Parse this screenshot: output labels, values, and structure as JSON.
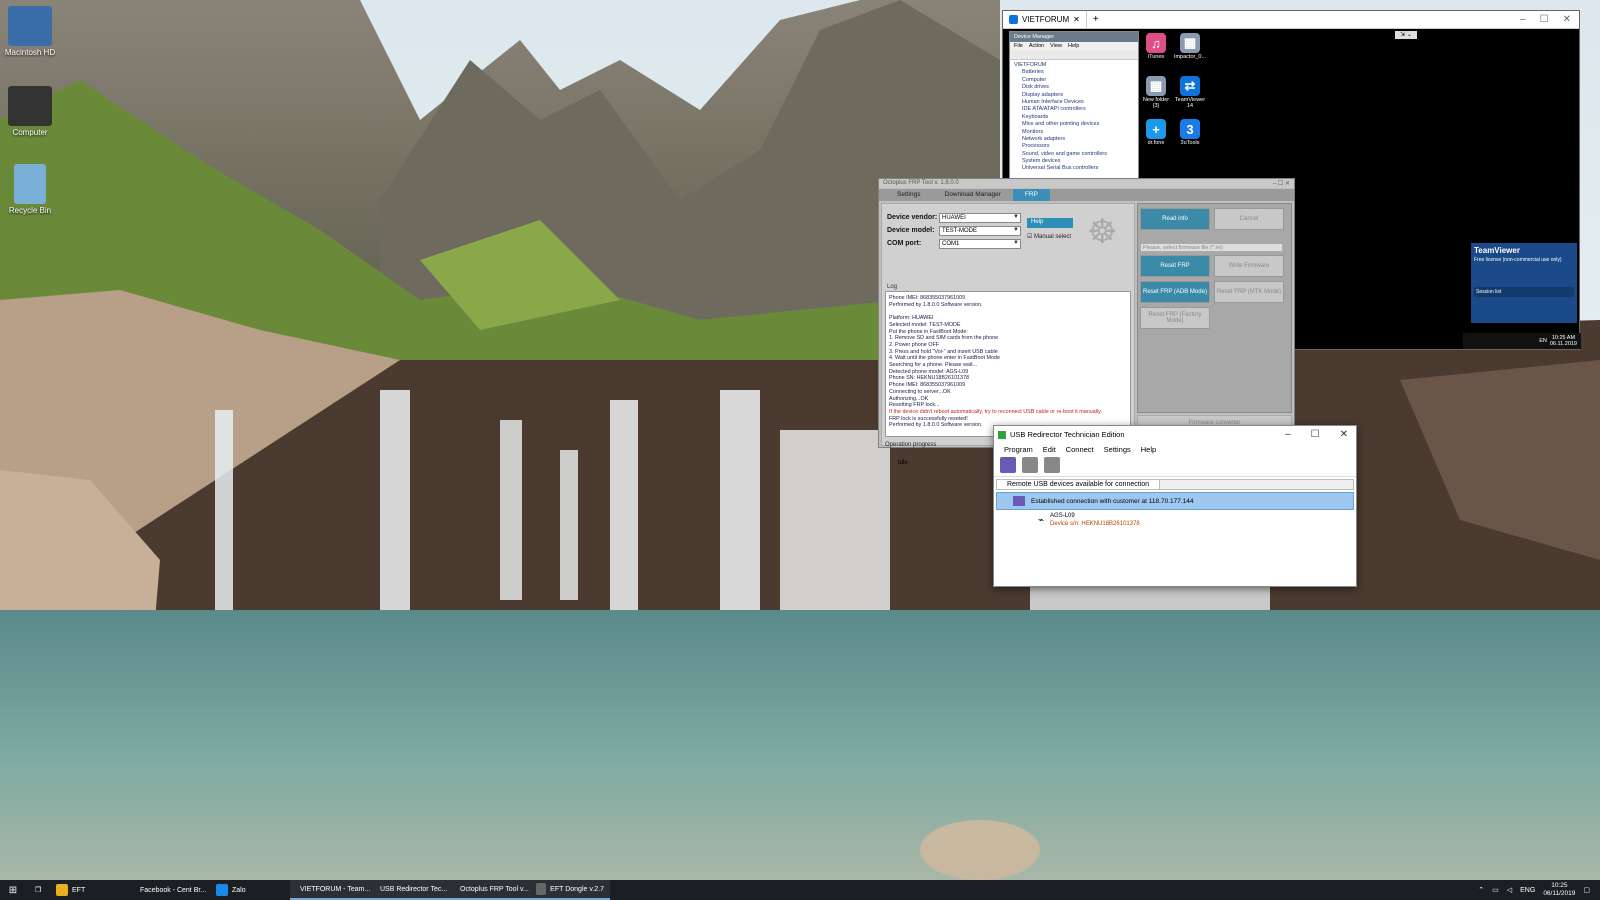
{
  "desktop": {
    "icons": [
      {
        "label": "Macintosh HD",
        "color": "#3a6ea8"
      },
      {
        "label": "Computer",
        "color": "#444"
      },
      {
        "label": "Recycle Bin",
        "color": "#7ab0d8"
      }
    ]
  },
  "remote": {
    "tab_title": "VIETFORUM",
    "device_manager": {
      "title": "Device Manager",
      "menu": [
        "File",
        "Action",
        "View",
        "Help"
      ],
      "tree": [
        "VIETFORUM",
        "Batteries",
        "Computer",
        "Disk drives",
        "Display adapters",
        "Human Interface Devices",
        "IDE ATA/ATAPI controllers",
        "Keyboards",
        "Mice and other pointing devices",
        "Monitors",
        "Network adapters",
        "Processors",
        "Sound, video and game controllers",
        "System devices",
        "Universal Serial Bus controllers"
      ]
    },
    "icons": [
      {
        "label": "iTunes",
        "glyph": "♫",
        "color": "#e04e8a"
      },
      {
        "label": "Impactor_0...",
        "glyph": "▦",
        "color": "#8a9ab0"
      },
      {
        "label": "New folder (3)",
        "glyph": "▦",
        "color": "#8a9ab0"
      },
      {
        "label": "TeamViewer 14",
        "glyph": "⇄",
        "color": "#0e74d8"
      },
      {
        "label": "dr.fone",
        "glyph": "+",
        "color": "#1a9ae8"
      },
      {
        "label": "3uTools",
        "glyph": "3",
        "color": "#1a7ae8"
      }
    ],
    "teamviewer": {
      "title": "TeamViewer",
      "subtitle": "Free license (non-commercial use only)",
      "session": "Session list"
    },
    "tray": {
      "lang": "EN",
      "time": "10:25 AM",
      "date": "06.11.2019"
    }
  },
  "octoplus": {
    "title": "Octoplus FRP Tool v. 1.8.0.0",
    "tabs": [
      "Settings",
      "Download Manager",
      "FRP"
    ],
    "active_tab": "FRP",
    "vendor_label": "Device vendor:",
    "vendor_value": "HUAWEI",
    "model_label": "Device model:",
    "model_value": "TEST-MODE",
    "port_label": "COM port:",
    "port_value": "COM1",
    "help_label": "Help",
    "manual_label": "Manual select",
    "log_label": "Log",
    "log_lines": [
      {
        "t": "Phone IMEI: 868355037961009",
        "r": false
      },
      {
        "t": "Performed by 1.8.0.0 Software version.",
        "r": false
      },
      {
        "t": "",
        "r": false
      },
      {
        "t": "Platform: HUAWEI",
        "r": false
      },
      {
        "t": "Selected model: TEST-MODE",
        "r": false
      },
      {
        "t": "Put the phone in FastBoot Mode:",
        "r": false
      },
      {
        "t": "1. Remove SD and SIM cards from the phone",
        "r": false
      },
      {
        "t": "2. Power phone OFF",
        "r": false
      },
      {
        "t": "3. Press and hold \"Vol-\" and insert USB cable",
        "r": false
      },
      {
        "t": "4. Wait until the phone enter in FastBoot Mode",
        "r": false
      },
      {
        "t": "Searching for a phone. Please wait...",
        "r": false
      },
      {
        "t": "Detected phone model: AGS-L09",
        "r": false
      },
      {
        "t": "Phone SN: HEKNU18B26101378",
        "r": false
      },
      {
        "t": "Phone IMEI: 868355037961009",
        "r": false
      },
      {
        "t": "Connecting to server...OK",
        "r": false
      },
      {
        "t": "Authorizing...OK",
        "r": false
      },
      {
        "t": "Resetting FRP lock...",
        "r": false
      },
      {
        "t": "If the device didn't reboot automatically, try to reconnect USB cable or re-boot it manually.",
        "r": true
      },
      {
        "t": "FRP lock is successfully reseted!",
        "r": false
      },
      {
        "t": "Performed by 1.8.0.0 Software version.",
        "r": false
      }
    ],
    "progress_label": "Operation progress",
    "status": "Idle",
    "buttons": {
      "read_info": "Read info",
      "cancel": "Cancel",
      "reset_frp": "Reset FRP",
      "write_firmware": "Write Firmware",
      "reset_frp_adb": "Reset FRP (ADB Mode)",
      "reset_frp_mtk": "Reset FRP (MTK Mode)",
      "reset_frp_factory": "Reset FRP (Factory Mode)",
      "firmware_converter": "Firmware converter"
    },
    "firmware_placeholder": "Please, select firmware file (*.ini)"
  },
  "usb": {
    "title": "USB Redirector Technician Edition",
    "menu": [
      "Program",
      "Edit",
      "Connect",
      "Settings",
      "Help"
    ],
    "header": "Remote USB devices available for connection",
    "connection": "Established connection with customer at 118.70.177.144",
    "device_name": "AGS-L09",
    "device_sn": "Device s/n: HEKNU18B26101378"
  },
  "taskbar": {
    "apps": [
      {
        "label": "EFT",
        "color": "#e8b020",
        "active": false
      },
      {
        "label": "Facebook - Cent Br...",
        "color": "#3a70e0",
        "active": false
      },
      {
        "label": "Zalo",
        "color": "#1a8ae8",
        "active": false
      },
      {
        "label": "VIETFORUM - Team...",
        "color": "#0e74d8",
        "active": true
      },
      {
        "label": "USB Redirector Tec...",
        "color": "#30a040",
        "active": true
      },
      {
        "label": "Octoplus FRP Tool v...",
        "color": "#e0a020",
        "active": true
      },
      {
        "label": "EFT Dongle v.2.7",
        "color": "#666",
        "active": true
      }
    ],
    "lang": "ENG",
    "time": "10:25",
    "date": "06/11/2019"
  }
}
